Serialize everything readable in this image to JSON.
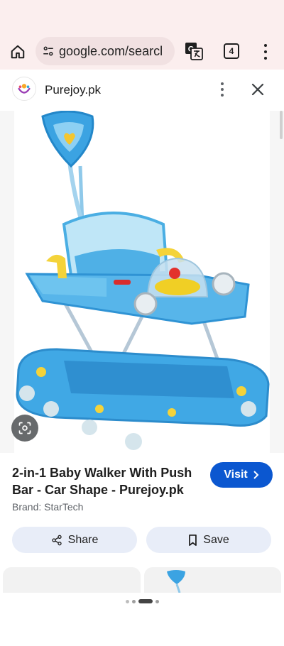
{
  "browser": {
    "url": "google.com/searcl",
    "tab_count": "4"
  },
  "viewer": {
    "site_name": "Purejoy.pk"
  },
  "result": {
    "title": "2-in-1 Baby Walker With Push Bar - Car Shape - Purejoy.pk",
    "brand": "Brand: StarTech",
    "visit_label": "Visit",
    "share_label": "Share",
    "save_label": "Save"
  },
  "icons": {
    "home": "home-icon",
    "tune": "tune-icon",
    "translate": "translate-icon",
    "menu": "more-vert-icon",
    "close": "close-icon",
    "lens": "lens-icon",
    "share": "share-icon",
    "save": "bookmark-icon",
    "chevron": "chevron-right-icon"
  },
  "colors": {
    "toolbar_bg": "#fbeeee",
    "visit_bg": "#0b57d0",
    "action_bg": "#e8edf8",
    "walker_blue": "#3fa9e6",
    "walker_yellow": "#f4d33a"
  }
}
